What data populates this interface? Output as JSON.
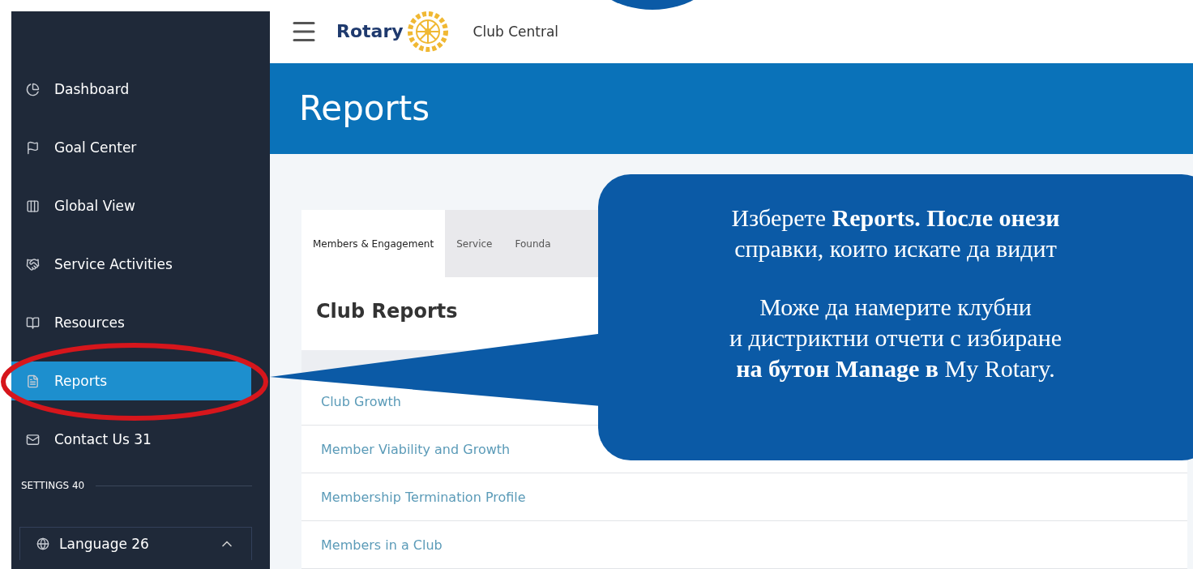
{
  "header": {
    "logo_text": "Rotary",
    "app_name": "Club Central"
  },
  "sidebar": {
    "items": [
      {
        "label": "Dashboard",
        "selected": false,
        "circled": false
      },
      {
        "label": "Goal Center",
        "selected": false,
        "circled": false
      },
      {
        "label": "Global View",
        "selected": false,
        "circled": false
      },
      {
        "label": "Service Activities",
        "selected": false,
        "circled": false
      },
      {
        "label": "Resources",
        "selected": false,
        "circled": false
      },
      {
        "label": "Reports",
        "selected": true,
        "circled": true
      },
      {
        "label": "Contact Us 31",
        "selected": false,
        "circled": false
      }
    ],
    "settings_label": "SETTINGS 40",
    "language": {
      "label": "Language 26",
      "expanded": true
    }
  },
  "page_title": "Reports",
  "tabs": [
    {
      "label": "Members & Engagement",
      "selected": true
    },
    {
      "label": "Service",
      "selected": false
    },
    {
      "label": "Founda",
      "selected": false
    }
  ],
  "section_title": "Club Reports",
  "rows": [
    "Club Growth",
    "Member Viability and Growth",
    "Membership Termination Profile",
    "Members in a Club"
  ],
  "callout": {
    "paragraphs": [
      "Изберете **Reports. После онези**\nсправки, които искате да видит",
      "Може да намерите клубни\nи дистриктни отчети с избиране\n**на бутон Manage в** My Rotary."
    ]
  }
}
